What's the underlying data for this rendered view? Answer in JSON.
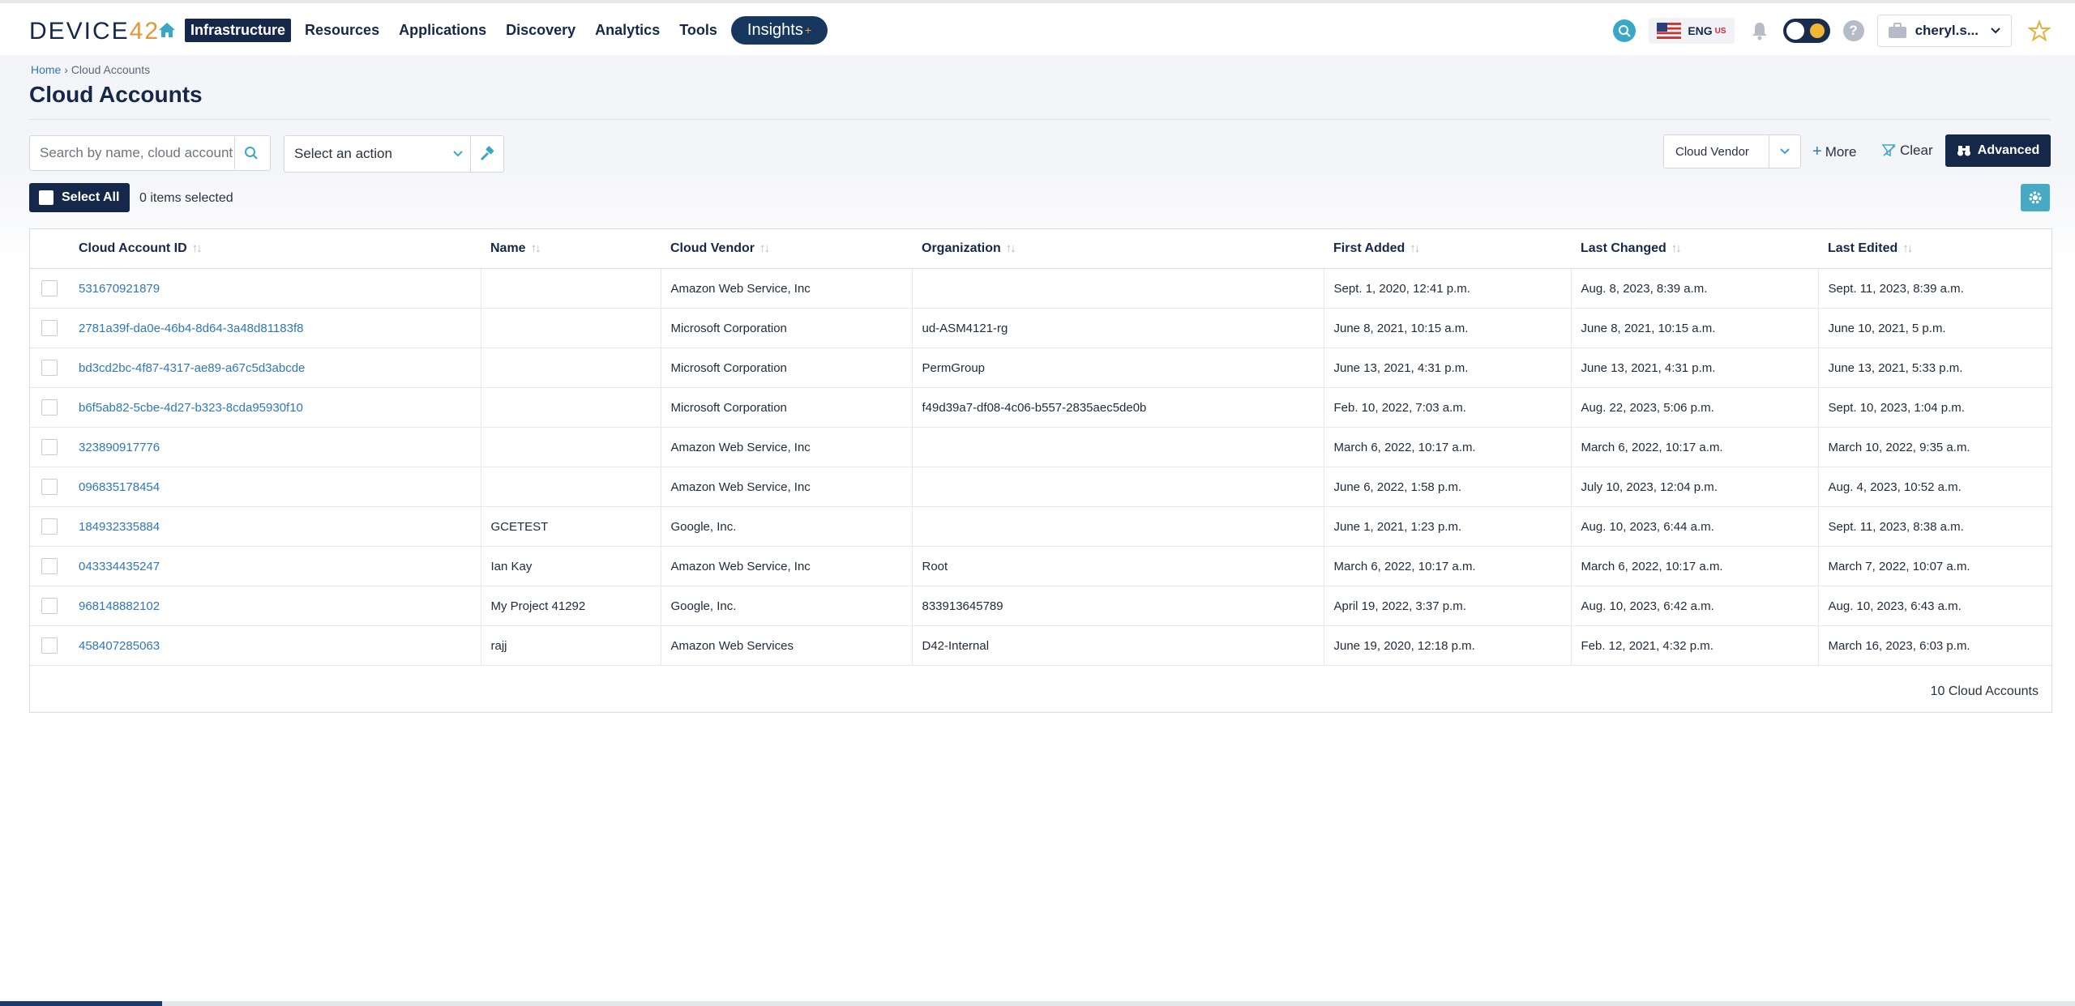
{
  "brand": {
    "logo_text": "DEVICE",
    "logo_num": "42"
  },
  "nav": {
    "items": [
      "Infrastructure",
      "Resources",
      "Applications",
      "Discovery",
      "Analytics",
      "Tools"
    ],
    "insights": "Insights",
    "insights_plus": "+"
  },
  "header": {
    "lang": "ENG",
    "lang_region": "US",
    "help": "?",
    "user": "cheryl.s..."
  },
  "breadcrumb": {
    "home": "Home",
    "sep": "›",
    "current": "Cloud Accounts"
  },
  "page": {
    "title": "Cloud Accounts"
  },
  "toolbar": {
    "search_placeholder": "Search by name, cloud account",
    "action_label": "Select an action",
    "vendor_filter": "Cloud Vendor",
    "more": "More",
    "clear": "Clear",
    "advanced": "Advanced",
    "select_all": "Select All",
    "items_selected": "0 items selected"
  },
  "table": {
    "columns": [
      "Cloud Account ID",
      "Name",
      "Cloud Vendor",
      "Organization",
      "First Added",
      "Last Changed",
      "Last Edited"
    ],
    "rows": [
      [
        "531670921879",
        "",
        "Amazon Web Service, Inc",
        "",
        "Sept. 1, 2020, 12:41 p.m.",
        "Aug. 8, 2023, 8:39 a.m.",
        "Sept. 11, 2023, 8:39 a.m."
      ],
      [
        "2781a39f-da0e-46b4-8d64-3a48d81183f8",
        "",
        "Microsoft Corporation",
        "ud-ASM4121-rg",
        "June 8, 2021, 10:15 a.m.",
        "June 8, 2021, 10:15 a.m.",
        "June 10, 2021, 5 p.m."
      ],
      [
        "bd3cd2bc-4f87-4317-ae89-a67c5d3abcde",
        "",
        "Microsoft Corporation",
        "PermGroup",
        "June 13, 2021, 4:31 p.m.",
        "June 13, 2021, 4:31 p.m.",
        "June 13, 2021, 5:33 p.m."
      ],
      [
        "b6f5ab82-5cbe-4d27-b323-8cda95930f10",
        "",
        "Microsoft Corporation",
        "f49d39a7-df08-4c06-b557-2835aec5de0b",
        "Feb. 10, 2022, 7:03 a.m.",
        "Aug. 22, 2023, 5:06 p.m.",
        "Sept. 10, 2023, 1:04 p.m."
      ],
      [
        "323890917776",
        "",
        "Amazon Web Service, Inc",
        "",
        "March 6, 2022, 10:17 a.m.",
        "March 6, 2022, 10:17 a.m.",
        "March 10, 2022, 9:35 a.m."
      ],
      [
        "096835178454",
        "",
        "Amazon Web Service, Inc",
        "",
        "June 6, 2022, 1:58 p.m.",
        "July 10, 2023, 12:04 p.m.",
        "Aug. 4, 2023, 10:52 a.m."
      ],
      [
        "184932335884",
        "GCETEST",
        "Google, Inc.",
        "",
        "June 1, 2021, 1:23 p.m.",
        "Aug. 10, 2023, 6:44 a.m.",
        "Sept. 11, 2023, 8:38 a.m."
      ],
      [
        "043334435247",
        "Ian Kay",
        "Amazon Web Service, Inc",
        "Root",
        "March 6, 2022, 10:17 a.m.",
        "March 6, 2022, 10:17 a.m.",
        "March 7, 2022, 10:07 a.m."
      ],
      [
        "968148882102",
        "My Project 41292",
        "Google, Inc.",
        "833913645789",
        "April 19, 2022, 3:37 p.m.",
        "Aug. 10, 2023, 6:42 a.m.",
        "Aug. 10, 2023, 6:43 a.m."
      ],
      [
        "458407285063",
        "rajj",
        "Amazon Web Services",
        "D42-Internal",
        "June 19, 2020, 12:18 p.m.",
        "Feb. 12, 2021, 4:32 p.m.",
        "March 16, 2023, 6:03 p.m."
      ]
    ],
    "footer": "10 Cloud Accounts"
  },
  "colors": {
    "navy": "#16284a",
    "link": "#2f77b8",
    "accent": "#48a9c5",
    "orange": "#e8943a"
  },
  "icons": [
    "home-icon",
    "search-icon",
    "chevron-down-icon",
    "hammer-icon",
    "plus-icon",
    "clear-filter-icon",
    "binoculars-icon",
    "gear-icon",
    "sort-icon",
    "bell-icon",
    "help-icon",
    "briefcase-icon",
    "star-icon",
    "flag-icon"
  ]
}
